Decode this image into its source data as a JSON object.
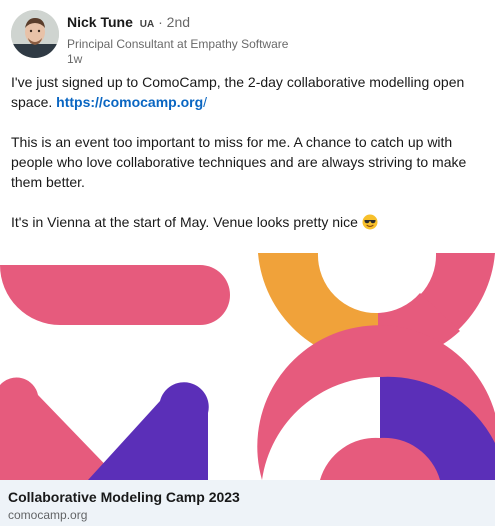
{
  "post": {
    "author": {
      "name": "Nick Tune",
      "badge": "UA",
      "degree": "· 2nd",
      "headline": "Principal Consultant at Empathy Software",
      "time": "1w"
    },
    "text": {
      "p1_before": "I've just signed up to ComoCamp, the 2-day collaborative modelling open space. ",
      "p1_link": "https://comocamp.org",
      "p1_after": "/",
      "p2": "This is an event too important to miss for me. A chance to catch up with people who love collaborative techniques and are always striving to make them better.",
      "p3": "It's in Vienna at the start of May. Venue looks pretty nice"
    },
    "emoji": "smiling-face-with-sunglasses-icon",
    "image": {
      "alt_colors": {
        "pink": "#e65b7d",
        "orange": "#f0a23a",
        "purple": "#5b2fb8"
      }
    },
    "link_card": {
      "title": "Collaborative Modeling Camp 2023",
      "domain": "comocamp.org"
    }
  }
}
